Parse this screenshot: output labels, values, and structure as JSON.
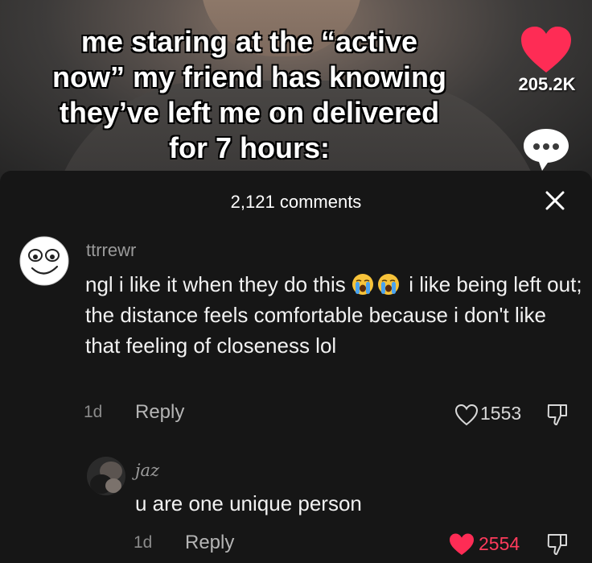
{
  "video": {
    "caption_lines": [
      "me staring at the “active",
      "now” my friend has knowing",
      "they’ve left me on delivered",
      "for 7 hours:"
    ],
    "like_count": "205.2K",
    "heart_color": "#fe2c55"
  },
  "comments_panel": {
    "count_label": "2,121 comments",
    "close_icon": "close-icon"
  },
  "comments": [
    {
      "username": "ttrrewr",
      "text_before": "ngl i like it when they do this ",
      "emojis": [
        "loudly-crying-face",
        "loudly-crying-face"
      ],
      "text_after": " i like being left out; the distance feels comfortable because i don't like that feeling of closeness lol",
      "age": "1d",
      "reply_label": "Reply",
      "likes": "1553",
      "liked": false
    },
    {
      "username": "jaz",
      "text": "u are one unique person",
      "age": "1d",
      "reply_label": "Reply",
      "likes": "2554",
      "liked": true
    }
  ]
}
